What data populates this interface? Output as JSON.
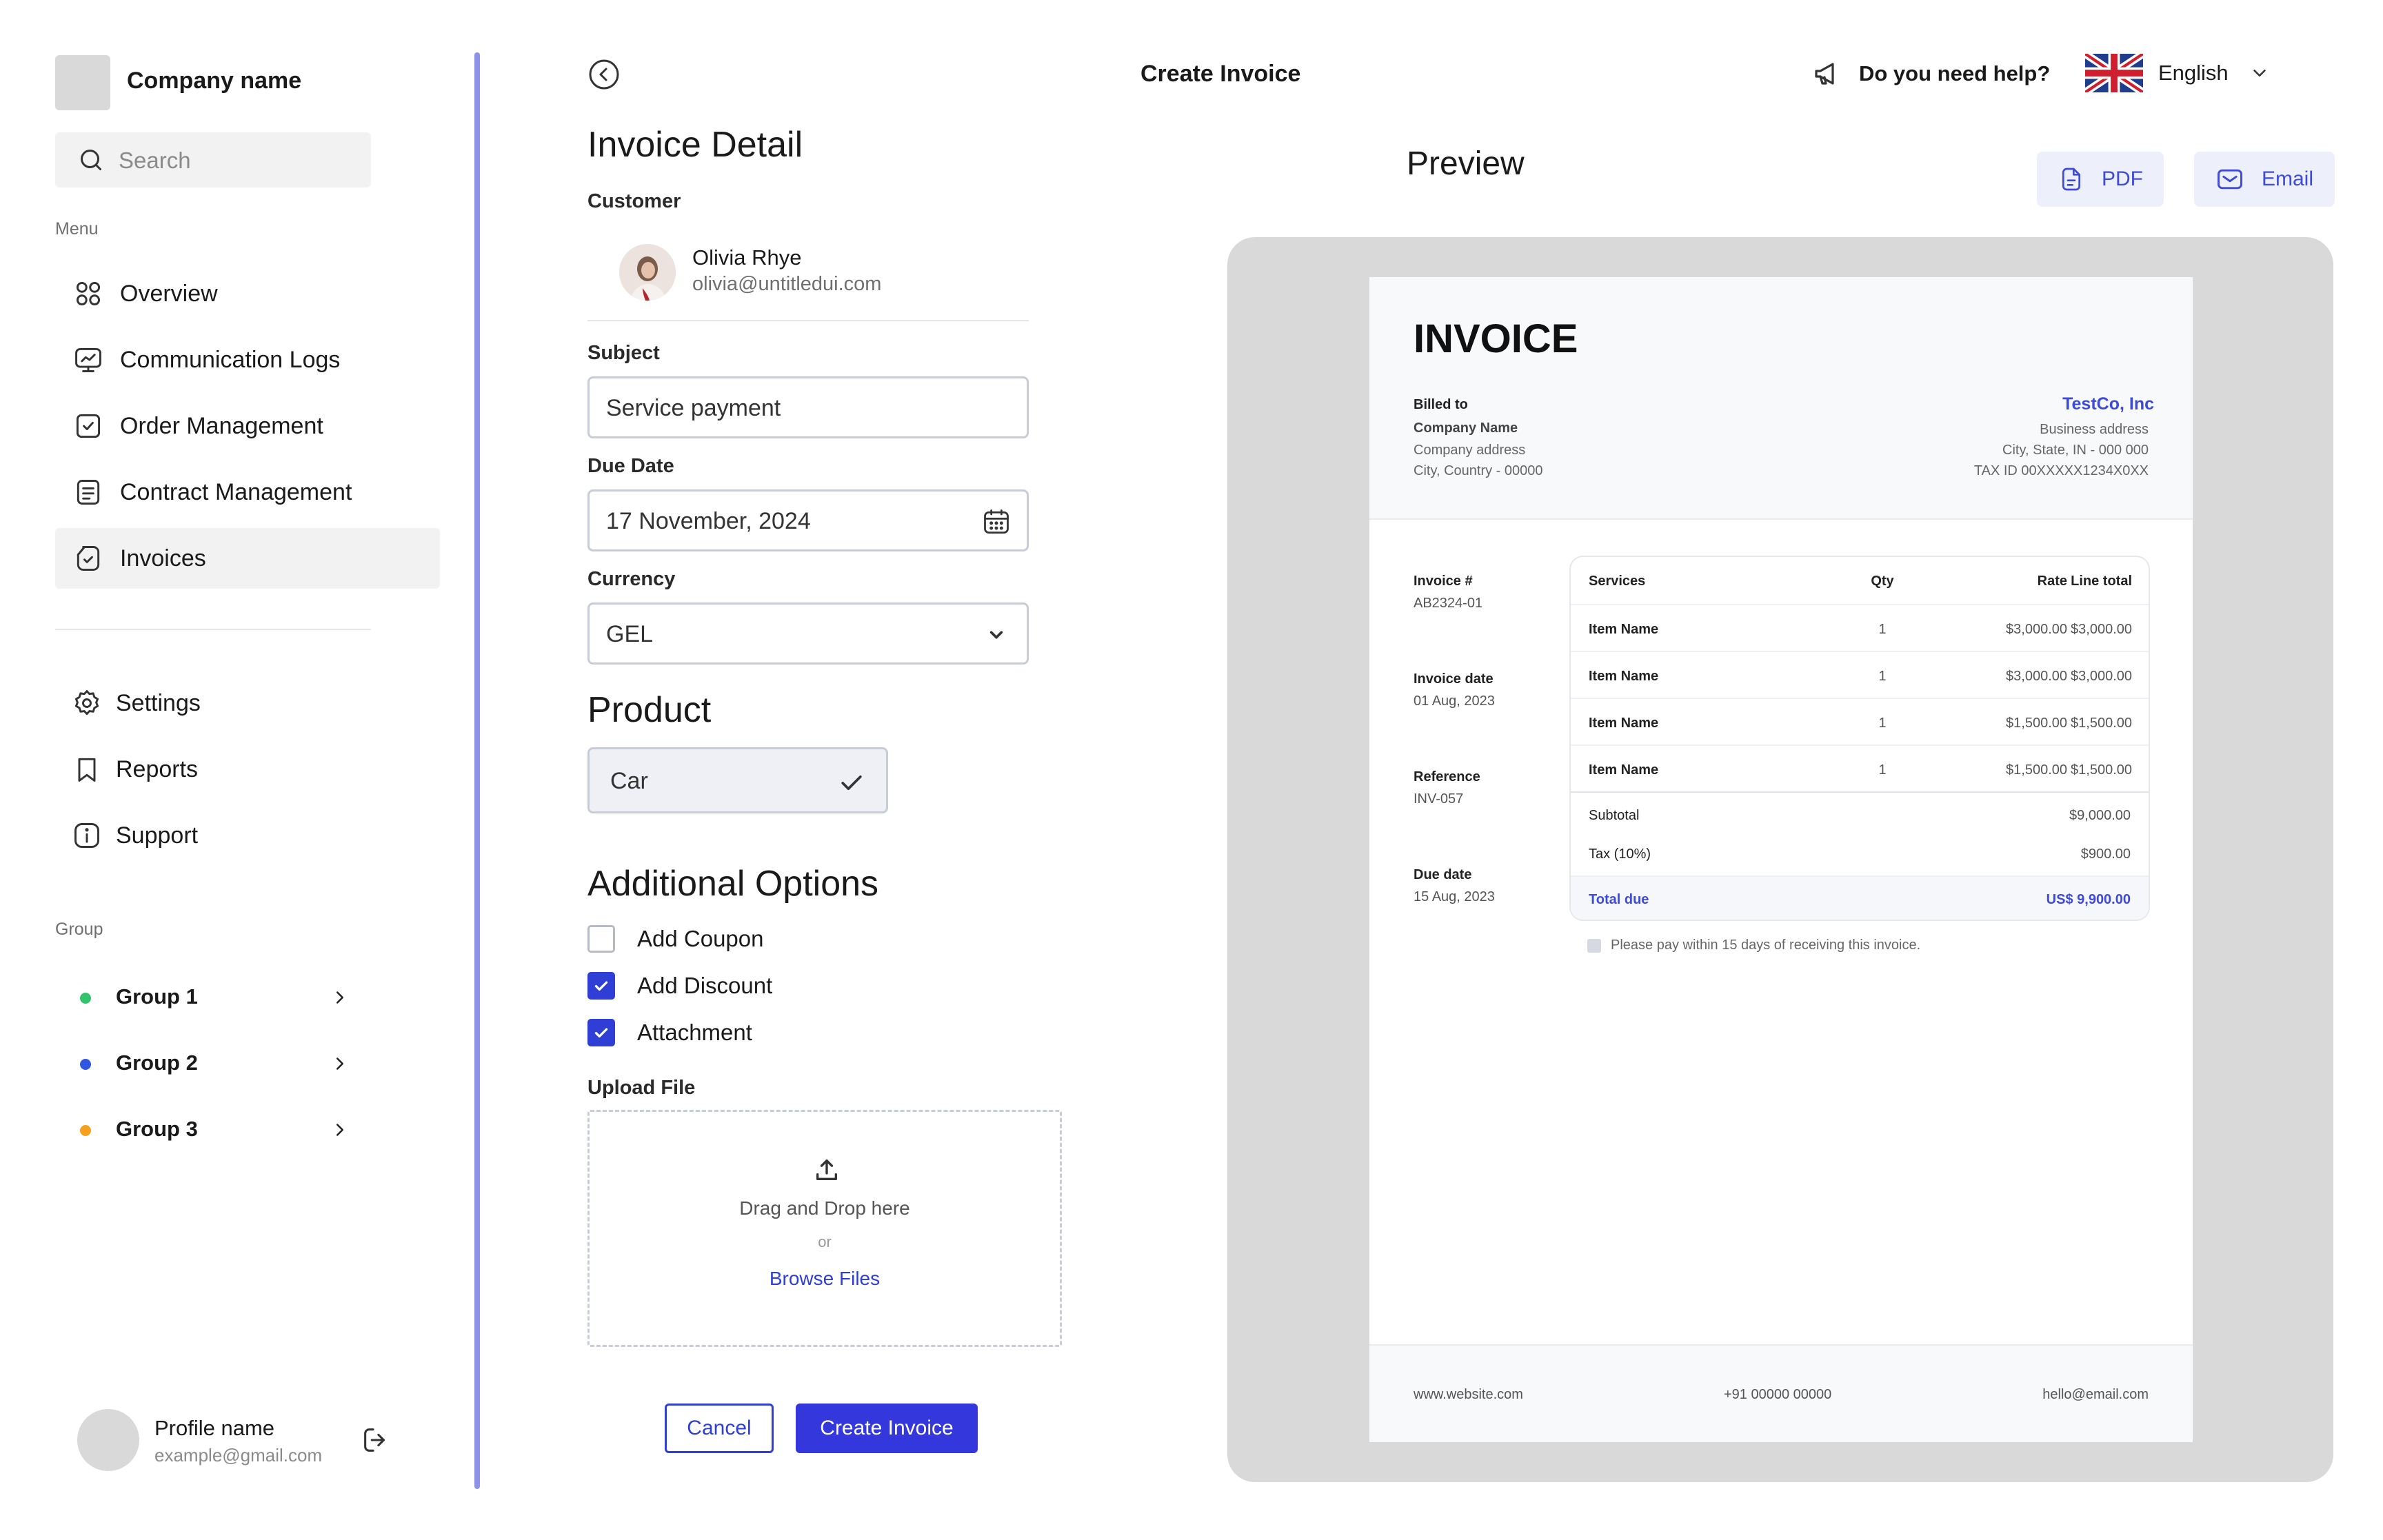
{
  "sidebar": {
    "company_name": "Company name",
    "search_placeholder": "Search",
    "menu_label": "Menu",
    "items": [
      {
        "label": "Overview",
        "icon": "grid-icon"
      },
      {
        "label": "Communication Logs",
        "icon": "monitor-chart-icon"
      },
      {
        "label": "Order Management",
        "icon": "check-square-icon"
      },
      {
        "label": "Contract Management",
        "icon": "document-lines-icon"
      },
      {
        "label": "Invoices",
        "icon": "invoice-check-icon",
        "active": true
      }
    ],
    "secondary_items": [
      {
        "label": "Settings",
        "icon": "gear-icon"
      },
      {
        "label": "Reports",
        "icon": "bookmark-icon"
      },
      {
        "label": "Support",
        "icon": "info-icon"
      }
    ],
    "group_label": "Group",
    "groups": [
      {
        "label": "Group 1",
        "color": "#31c46c"
      },
      {
        "label": "Group 2",
        "color": "#3157e0"
      },
      {
        "label": "Group 3",
        "color": "#f5a11d"
      }
    ],
    "profile": {
      "name": "Profile name",
      "email": "example@gmail.com"
    }
  },
  "header": {
    "title": "Create Invoice",
    "help": "Do you need help?",
    "language": "English"
  },
  "form": {
    "heading": "Invoice Detail",
    "customer_label": "Customer",
    "customer": {
      "name": "Olivia Rhye",
      "email": "olivia@untitledui.com"
    },
    "subject_label": "Subject",
    "subject_value": "Service payment",
    "due_date_label": "Due Date",
    "due_date_value": "17 November, 2024",
    "currency_label": "Currency",
    "currency_value": "GEL",
    "product_heading": "Product",
    "product_value": "Car",
    "additional_heading": "Additional Options",
    "options": [
      {
        "label": "Add Coupon",
        "checked": false
      },
      {
        "label": "Add Discount",
        "checked": true
      },
      {
        "label": "Attachment",
        "checked": true
      }
    ],
    "upload_label": "Upload File",
    "upload_drag": "Drag and Drop here",
    "upload_or": "or",
    "upload_browse": "Browse Files",
    "cancel": "Cancel",
    "create": "Create Invoice"
  },
  "preview": {
    "title": "Preview",
    "pdf": "PDF",
    "email": "Email",
    "invoice": {
      "title": "INVOICE",
      "billed_to": "Billed to",
      "bill_company": "Company Name",
      "bill_address": "Company address",
      "bill_city": "City, Country - 00000",
      "company": "TestCo, Inc",
      "company_address": "Business address",
      "company_city": "City, State, IN - 000 000",
      "company_tax": "TAX ID 00XXXXX1234X0XX",
      "meta": [
        {
          "label": "Invoice #",
          "value": "AB2324-01"
        },
        {
          "label": "Invoice date",
          "value": "01 Aug, 2023"
        },
        {
          "label": "Reference",
          "value": "INV-057"
        },
        {
          "label": "Due date",
          "value": "15 Aug, 2023"
        }
      ],
      "columns": {
        "services": "Services",
        "qty": "Qty",
        "rate": "Rate",
        "total": "Line total"
      },
      "rows": [
        {
          "name": "Item Name",
          "qty": "1",
          "rate": "$3,000.00",
          "total": "$3,000.00"
        },
        {
          "name": "Item Name",
          "qty": "1",
          "rate": "$3,000.00",
          "total": "$3,000.00"
        },
        {
          "name": "Item Name",
          "qty": "1",
          "rate": "$1,500.00",
          "total": "$1,500.00"
        },
        {
          "name": "Item Name",
          "qty": "1",
          "rate": "$1,500.00",
          "total": "$1,500.00"
        }
      ],
      "subtotal_label": "Subtotal",
      "subtotal_value": "$9,000.00",
      "tax_label": "Tax (10%)",
      "tax_value": "$900.00",
      "total_label": "Total due",
      "total_value": "US$ 9,900.00",
      "note": "Please pay within 15 days of receiving this invoice.",
      "footer": {
        "website": "www.website.com",
        "phone": "+91 00000 00000",
        "email": "hello@email.com"
      }
    }
  }
}
